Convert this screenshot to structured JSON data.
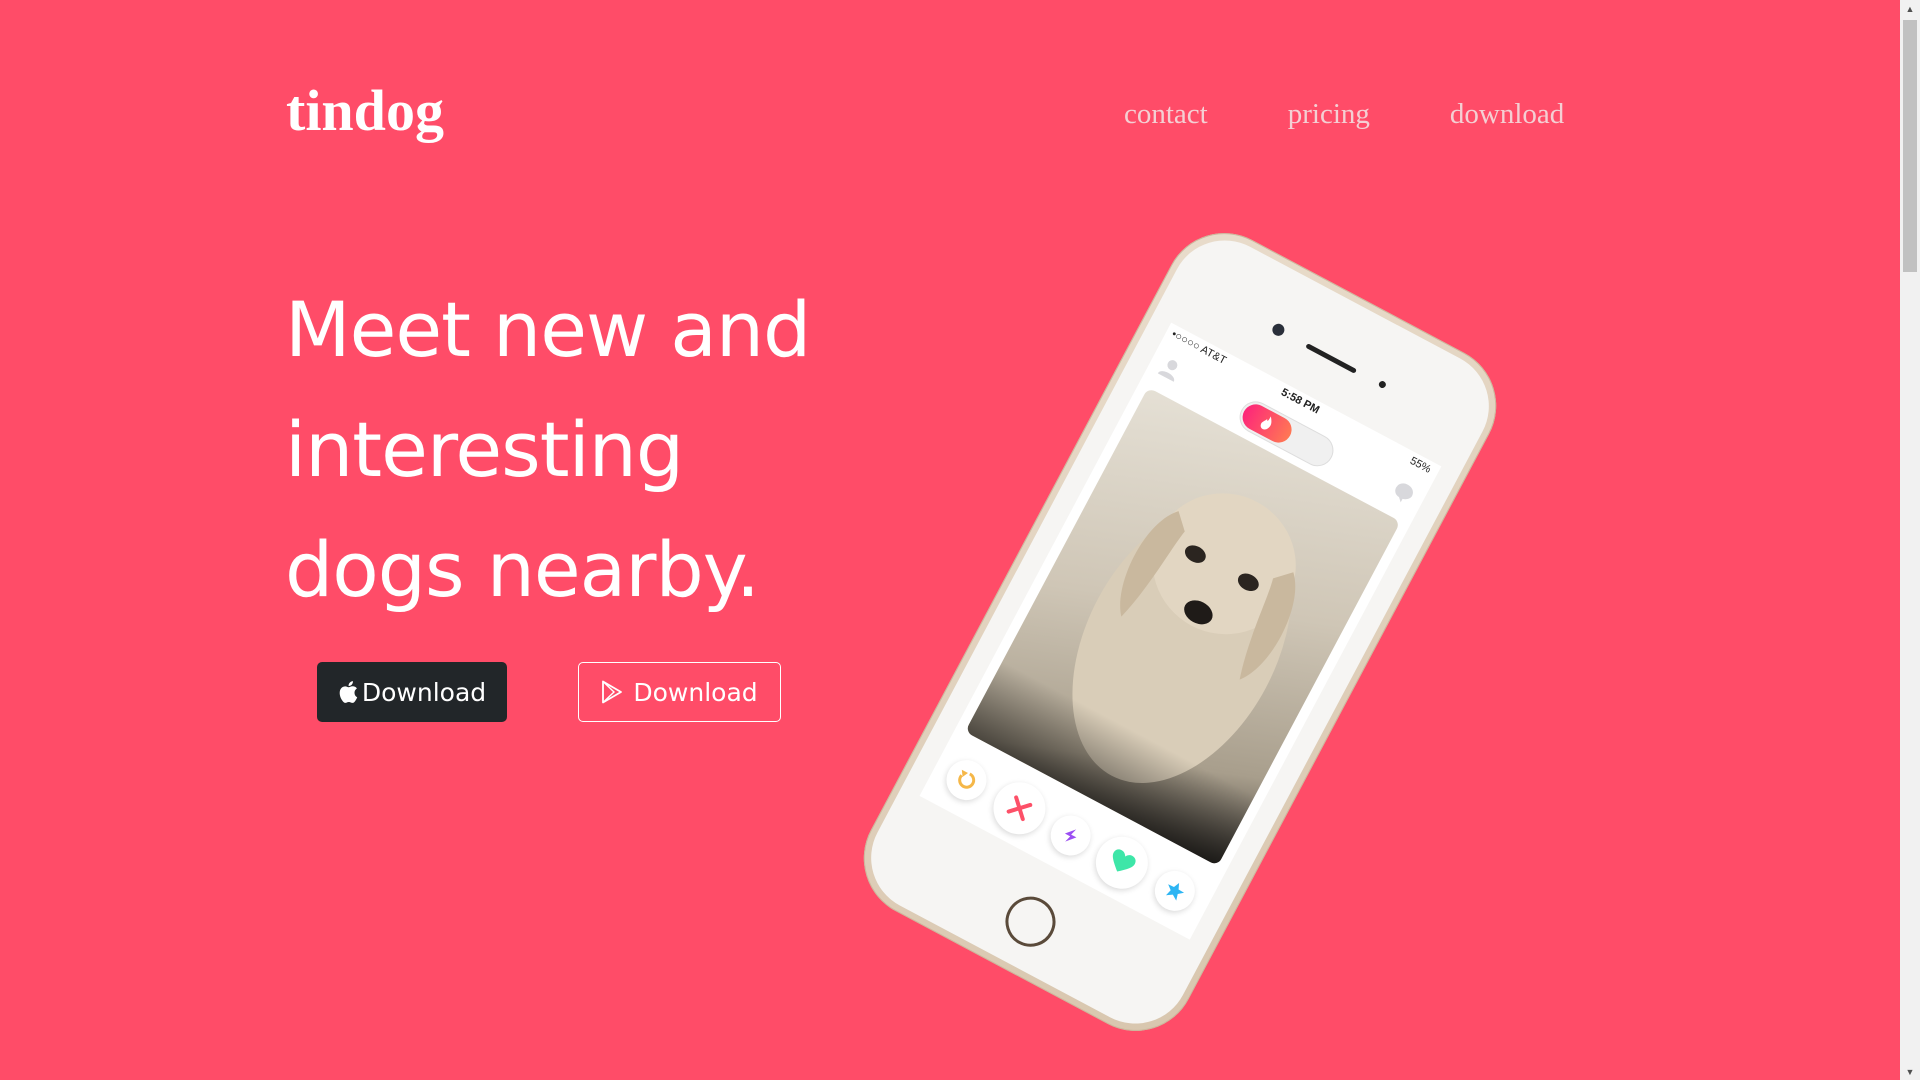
{
  "header": {
    "brand": "tindog",
    "nav": [
      {
        "label": "contact"
      },
      {
        "label": "pricing"
      },
      {
        "label": "download"
      }
    ]
  },
  "hero": {
    "headline_lines": [
      "Meet new and",
      "interesting",
      "dogs nearby."
    ],
    "buttons": {
      "apple": {
        "label": "Download",
        "icon": "apple-icon"
      },
      "play": {
        "label": "Download",
        "icon": "google-play-icon"
      }
    }
  },
  "phone": {
    "status": {
      "carrier": "•○○○○ AT&T",
      "time": "5:58 PM",
      "battery": "55%"
    },
    "actions": [
      "rewind-icon",
      "nope-icon",
      "boost-icon",
      "like-icon",
      "super-like-icon"
    ]
  },
  "colors": {
    "background": "#ff4c68",
    "apple_button": "#222629",
    "nav_text": "#f4cfd3"
  }
}
